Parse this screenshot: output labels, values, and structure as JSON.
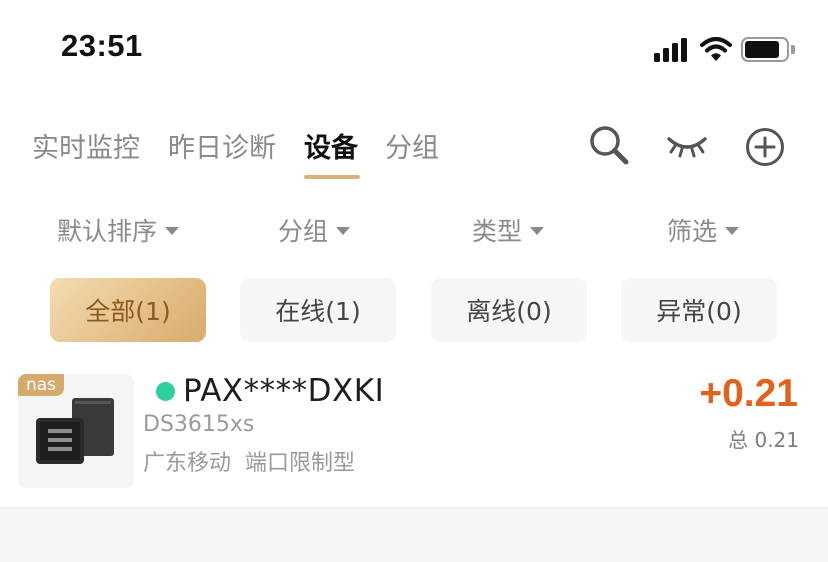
{
  "status_bar": {
    "time": "23:51",
    "battery_level": 0.85
  },
  "tabs": [
    {
      "label": "实时监控",
      "active": false
    },
    {
      "label": "昨日诊断",
      "active": false
    },
    {
      "label": "设备",
      "active": true
    },
    {
      "label": "分组",
      "active": false
    }
  ],
  "header_icons": [
    "search-icon",
    "eye-closed-icon",
    "add-circle-icon"
  ],
  "filters": [
    {
      "label": "默认排序"
    },
    {
      "label": "分组"
    },
    {
      "label": "类型"
    },
    {
      "label": "筛选"
    }
  ],
  "status_chips": [
    {
      "label": "全部(1)",
      "active": true
    },
    {
      "label": "在线(1)",
      "active": false
    },
    {
      "label": "离线(0)",
      "active": false
    },
    {
      "label": "异常(0)",
      "active": false
    }
  ],
  "device": {
    "tag": "nas",
    "name": "PAX****DXKI",
    "online": true,
    "model": "DS3615xs",
    "isp": "广东移动",
    "port_type": "端口限制型",
    "earnings": "+0.21",
    "total": "总 0.21"
  },
  "colors": {
    "accent": "#d8b27d",
    "earnings": "#e2621b",
    "online": "#2ccf9e"
  }
}
